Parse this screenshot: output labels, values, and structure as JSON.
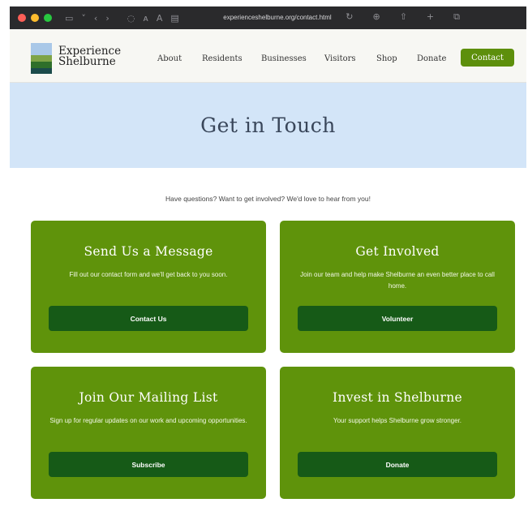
{
  "browser": {
    "url": "experienceshelburne.org/contact.html",
    "dot_colors": [
      "#ff5f57",
      "#febc2e",
      "#28c840"
    ]
  },
  "site": {
    "logo_line1": "Experience",
    "logo_line2": "Shelburne",
    "nav": [
      "About",
      "Residents",
      "Businesses",
      "Visitors",
      "Shop",
      "Donate"
    ],
    "nav_cta": "Contact"
  },
  "hero": {
    "title": "Get in Touch"
  },
  "intro": "Have questions? Want to get involved? We'd love to hear from you!",
  "cards": [
    {
      "title": "Send Us a Message",
      "text": "Fill out our contact form and we'll get back to you soon.",
      "button": "Contact Us"
    },
    {
      "title": "Get Involved",
      "text": "Join our team and help make Shelburne an even better place to call home.",
      "button": "Volunteer"
    },
    {
      "title": "Join Our Mailing List",
      "text": "Sign up for regular updates on our work and upcoming opportunities.",
      "button": "Subscribe"
    },
    {
      "title": "Invest in Shelburne",
      "text": "Your support helps Shelburne grow stronger.",
      "button": "Donate"
    }
  ],
  "colors": {
    "brand_green": "#5f930b",
    "button_dark_green": "#165a17",
    "hero_blue": "#d3e5f8"
  }
}
